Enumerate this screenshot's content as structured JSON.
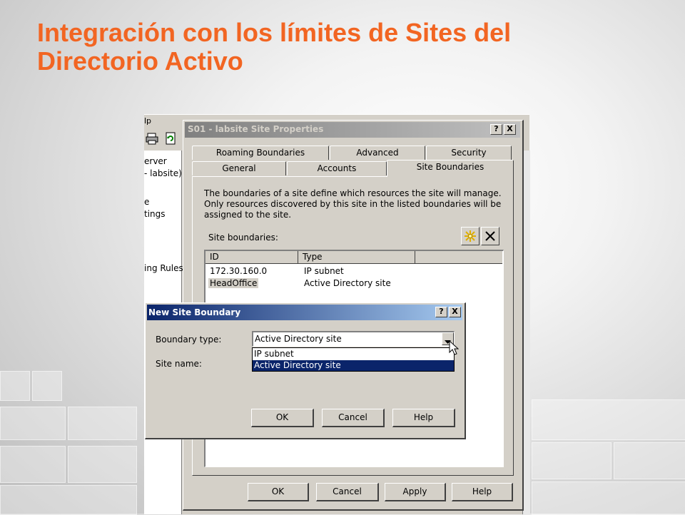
{
  "slide": {
    "title_line1": "Integración con los límites de Sites del",
    "title_line2": "Directorio Activo"
  },
  "background_window": {
    "menu_fragment": "lp",
    "tree_items": [
      "erver",
      "- labsite)",
      "e",
      "tings",
      "ing Rules"
    ]
  },
  "properties_dialog": {
    "title": "S01 - labsite Site Properties",
    "help_button": "?",
    "close_button": "X",
    "tabs_back_row": [
      "Roaming Boundaries",
      "Advanced",
      "Security"
    ],
    "tabs_front_row": [
      "General",
      "Accounts",
      "Site Boundaries"
    ],
    "active_tab": "Site Boundaries",
    "description": "The boundaries of a site define which resources the site will manage. Only resources discovered by this site in the listed boundaries will be assigned to the site.",
    "list_label": "Site boundaries:",
    "columns": [
      "ID",
      "Type"
    ],
    "rows": [
      {
        "id": "172.30.160.0",
        "type": "IP subnet"
      },
      {
        "id": "HeadOffice",
        "type": "Active Directory site"
      }
    ],
    "buttons": {
      "ok": "OK",
      "cancel": "Cancel",
      "apply": "Apply",
      "help": "Help"
    }
  },
  "new_boundary_dialog": {
    "title": "New Site Boundary",
    "help_button": "?",
    "close_button": "X",
    "boundary_type_label": "Boundary type:",
    "site_name_label": "Site name:",
    "selected_value": "Active Directory site",
    "options": [
      "IP subnet",
      "Active Directory site"
    ],
    "highlighted_option": "Active Directory site",
    "buttons": {
      "ok": "OK",
      "cancel": "Cancel",
      "help": "Help"
    }
  },
  "colors": {
    "title_orange": "#f26522",
    "active_titlebar": "#0a246a",
    "inactive_titlebar": "#808080",
    "selection": "#0a246a",
    "dialog_face": "#d4d0c8"
  }
}
